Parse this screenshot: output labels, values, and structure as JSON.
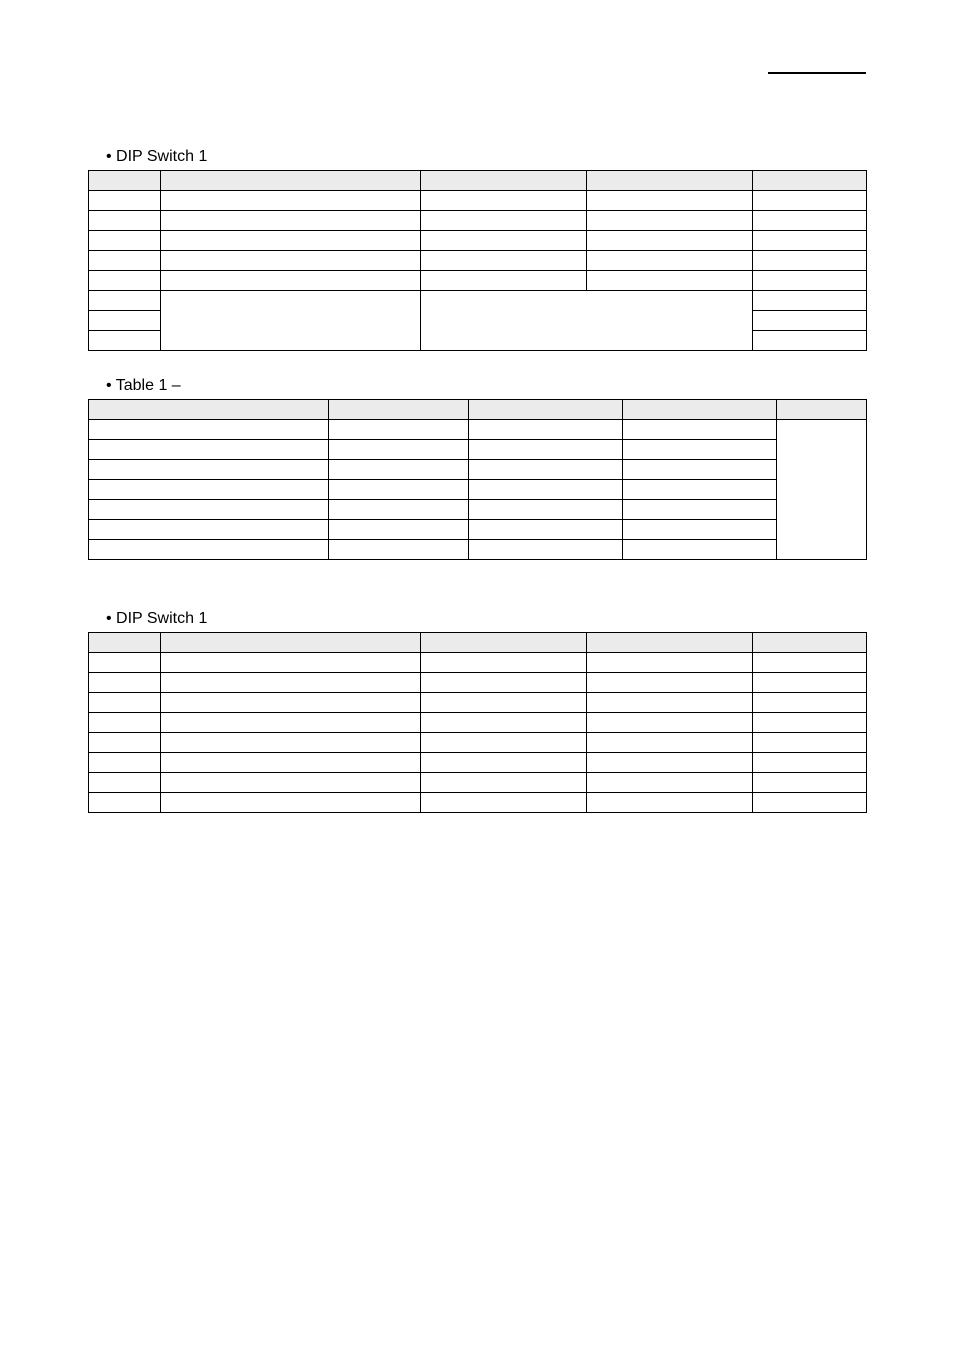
{
  "sections": {
    "s1": {
      "title": "• DIP Switch 1"
    },
    "s2": {
      "title": "• Table 1 –"
    },
    "s3": {
      "title": "• DIP Switch 1"
    }
  },
  "table_a1": {
    "header": [
      "",
      "",
      "",
      "",
      ""
    ],
    "rows": [
      [
        "",
        "",
        "",
        "",
        ""
      ],
      [
        "",
        "",
        "",
        "",
        ""
      ],
      [
        "",
        "",
        "",
        "",
        ""
      ],
      [
        "",
        "",
        "",
        "",
        ""
      ],
      [
        "",
        "",
        "",
        "",
        ""
      ]
    ],
    "merged": [
      {
        "c1": "",
        "c2": "",
        "c3": "",
        "c5": ""
      },
      {
        "c1": "",
        "c5": ""
      },
      {
        "c1": "",
        "c5": ""
      }
    ]
  },
  "table_b": {
    "header": [
      "",
      "",
      "",
      "",
      ""
    ],
    "rows": [
      {
        "cells": [
          "",
          "",
          "",
          ""
        ],
        "right_merged": ""
      },
      {
        "cells": [
          "",
          "",
          "",
          ""
        ]
      },
      {
        "cells": [
          "",
          "",
          "",
          ""
        ]
      },
      {
        "cells": [
          "",
          "",
          "",
          ""
        ]
      },
      {
        "cells": [
          "",
          "",
          "",
          ""
        ]
      },
      {
        "cells": [
          "",
          "",
          "",
          ""
        ]
      },
      {
        "cells": [
          "",
          "",
          "",
          ""
        ]
      }
    ]
  },
  "table_a2": {
    "header": [
      "",
      "",
      "",
      "",
      ""
    ],
    "rows": [
      [
        "",
        "",
        "",
        "",
        ""
      ],
      [
        "",
        "",
        "",
        "",
        ""
      ],
      [
        "",
        "",
        "",
        "",
        ""
      ],
      [
        "",
        "",
        "",
        "",
        ""
      ],
      [
        "",
        "",
        "",
        "",
        ""
      ],
      [
        "",
        "",
        "",
        "",
        ""
      ],
      [
        "",
        "",
        "",
        "",
        ""
      ],
      [
        "",
        "",
        "",
        "",
        ""
      ]
    ]
  }
}
